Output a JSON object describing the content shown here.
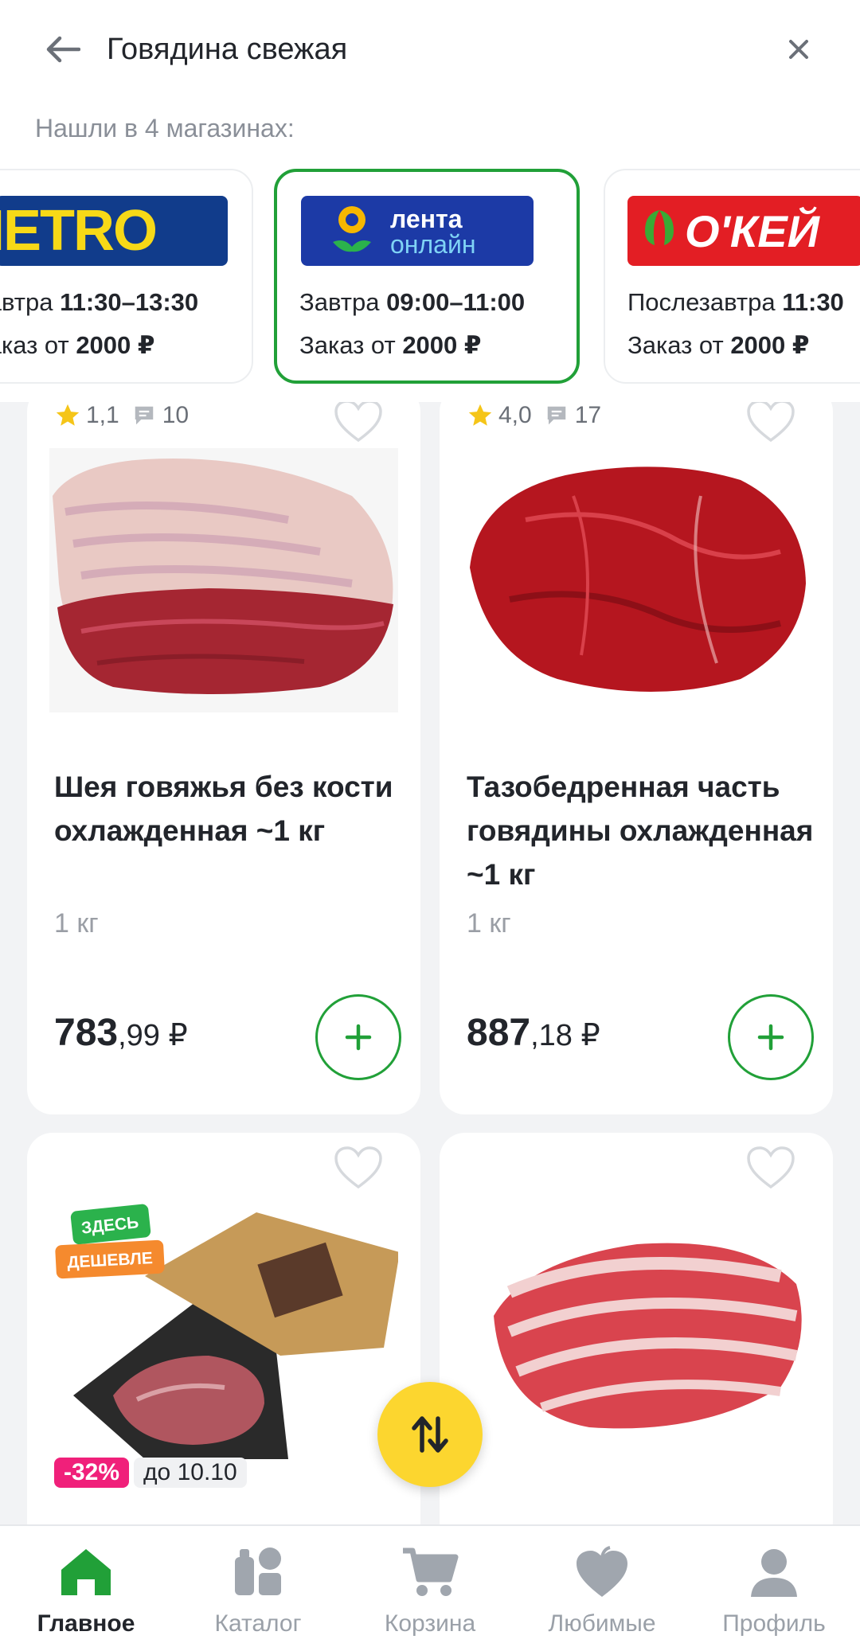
{
  "search": {
    "query": "Говядина свежая"
  },
  "stores_label": "Нашли в 4 магазинах:",
  "stores": [
    {
      "name": "METRO",
      "logo_text": "METRO",
      "delivery_day": "Завтра",
      "delivery_time": "11:30–13:30",
      "order_prefix": "Заказ от",
      "order_min": "2000 ₽"
    },
    {
      "name": "Лента онлайн",
      "logo_line1": "лента",
      "logo_line2": "онлайн",
      "delivery_day": "Завтра",
      "delivery_time": "09:00–11:00",
      "order_prefix": "Заказ от",
      "order_min": "2000 ₽",
      "selected": true
    },
    {
      "name": "О'КЕЙ",
      "logo_text": "О'КЕЙ",
      "delivery_day": "Послезавтра",
      "delivery_time": "11:30",
      "order_prefix": "Заказ от",
      "order_min": "2000 ₽"
    }
  ],
  "products": [
    {
      "rating": "1,1",
      "reviews": "10",
      "title": "Шея говяжья без кости охлажденная ~1 кг",
      "unit": "1 кг",
      "price_rub": "783",
      "price_kop": ",99 ₽"
    },
    {
      "rating": "4,0",
      "reviews": "17",
      "title": "Тазобедренная часть говядины охлажденная ~1 кг",
      "unit": "1 кг",
      "price_rub": "887",
      "price_kop": ",18 ₽"
    },
    {
      "badge_line1": "ЗДЕСЬ",
      "badge_line2": "ДЕШЕВЛЕ",
      "discount": "-32%",
      "discount_until": "до 10.10"
    },
    {}
  ],
  "nav": [
    {
      "label": "Главное",
      "icon": "home-icon",
      "active": true
    },
    {
      "label": "Каталог",
      "icon": "catalog-icon"
    },
    {
      "label": "Корзина",
      "icon": "cart-icon"
    },
    {
      "label": "Любимые",
      "icon": "favorites-icon"
    },
    {
      "label": "Профиль",
      "icon": "profile-icon"
    }
  ],
  "colors": {
    "accent": "#21a038",
    "fab": "#fcd62f",
    "discount": "#f0207a",
    "star": "#f5c518"
  }
}
